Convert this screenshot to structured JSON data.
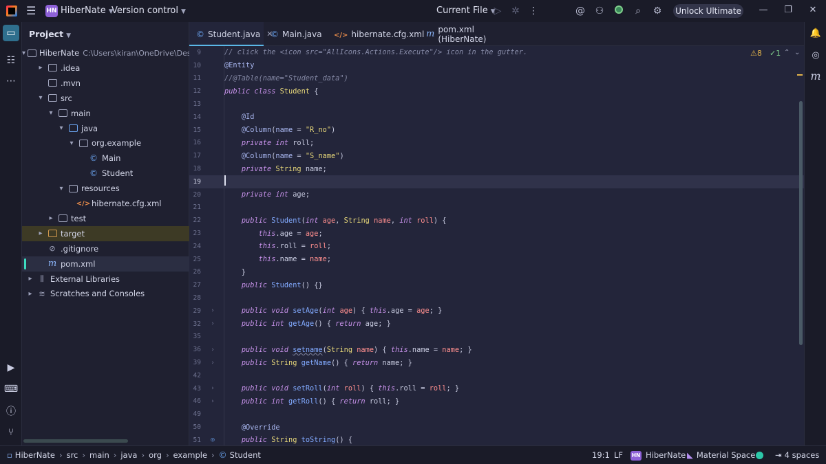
{
  "titlebar": {
    "project_badge": "HN",
    "project_name": "HiberNate",
    "vcs_label": "Version control",
    "run_config": "Current File",
    "unlock_label": "Unlock Ultimate"
  },
  "project_panel": {
    "header": "Project",
    "tree": [
      {
        "label": "HiberNate",
        "path": "C:\\Users\\kiran\\OneDrive\\Deskt",
        "indent": 0,
        "arrow": "▾",
        "icon": "folder"
      },
      {
        "label": ".idea",
        "indent": 1,
        "arrow": "▸",
        "icon": "folder"
      },
      {
        "label": ".mvn",
        "indent": 1,
        "arrow": "",
        "icon": "folder"
      },
      {
        "label": "src",
        "indent": 1,
        "arrow": "▾",
        "icon": "folder"
      },
      {
        "label": "main",
        "indent": 2,
        "arrow": "▾",
        "icon": "folder"
      },
      {
        "label": "java",
        "indent": 3,
        "arrow": "▾",
        "icon": "folder-blue"
      },
      {
        "label": "org.example",
        "indent": 4,
        "arrow": "▾",
        "icon": "folder"
      },
      {
        "label": "Main",
        "indent": 5,
        "arrow": "",
        "icon": "class"
      },
      {
        "label": "Student",
        "indent": 5,
        "arrow": "",
        "icon": "class"
      },
      {
        "label": "resources",
        "indent": 3,
        "arrow": "▾",
        "icon": "folder"
      },
      {
        "label": "hibernate.cfg.xml",
        "indent": 4,
        "arrow": "",
        "icon": "xml"
      },
      {
        "label": "test",
        "indent": 2,
        "arrow": "▸",
        "icon": "folder"
      },
      {
        "label": "target",
        "indent": 1,
        "arrow": "▸",
        "icon": "folder-orange",
        "highlight": "target"
      },
      {
        "label": ".gitignore",
        "indent": 1,
        "arrow": "",
        "icon": "gitignore"
      },
      {
        "label": "pom.xml",
        "indent": 1,
        "arrow": "",
        "icon": "maven",
        "highlight": "selected"
      },
      {
        "label": "External Libraries",
        "indent": 0,
        "arrow": "▸",
        "icon": "libraries"
      },
      {
        "label": "Scratches and Consoles",
        "indent": 0,
        "arrow": "▸",
        "icon": "scratches"
      }
    ]
  },
  "tabs": [
    {
      "label": "Student.java",
      "icon": "class",
      "active": true,
      "closable": true
    },
    {
      "label": "Main.java",
      "icon": "class",
      "active": false
    },
    {
      "label": "hibernate.cfg.xml",
      "icon": "xml",
      "active": false
    },
    {
      "label": "pom.xml (HiberNate)",
      "icon": "maven",
      "active": false
    }
  ],
  "inspections": {
    "warnings": "8",
    "weak_warnings": "1"
  },
  "code": [
    {
      "n": "9",
      "fold": "",
      "html": "<span class=\"cm\">// click the &lt;icon src=\"AllIcons.Actions.Execute\"/&gt; icon in the gutter.</span>"
    },
    {
      "n": "10",
      "fold": "",
      "html": "<span class=\"an\">@Entity</span>"
    },
    {
      "n": "11",
      "fold": "",
      "html": "<span class=\"cm\">//@Table(name=\"Student_data\")</span>"
    },
    {
      "n": "12",
      "fold": "",
      "html": "<span class=\"kw\">public class</span> <span class=\"ty\">Student</span> {"
    },
    {
      "n": "13",
      "fold": "",
      "html": ""
    },
    {
      "n": "14",
      "fold": "",
      "html": "    <span class=\"an\">@Id</span>"
    },
    {
      "n": "15",
      "fold": "",
      "html": "    <span class=\"an\">@Column</span>(<span class=\"an\">name</span> = <span class=\"str\">\"R_no\"</span>)"
    },
    {
      "n": "16",
      "fold": "",
      "html": "    <span class=\"kw\">private int</span> roll;"
    },
    {
      "n": "17",
      "fold": "",
      "html": "    <span class=\"an\">@Column</span>(<span class=\"an\">name</span> = <span class=\"str\">\"S_name\"</span>)"
    },
    {
      "n": "18",
      "fold": "",
      "html": "    <span class=\"kw\">private</span> <span class=\"ty\">String</span> name;"
    },
    {
      "n": "19",
      "fold": "",
      "html": "",
      "current": true
    },
    {
      "n": "20",
      "fold": "",
      "html": "    <span class=\"kw\">private int</span> age;"
    },
    {
      "n": "21",
      "fold": "",
      "html": ""
    },
    {
      "n": "22",
      "fold": "",
      "html": "    <span class=\"kw\">public</span> <span class=\"fn\">Student</span>(<span class=\"kw\">int</span> <span class=\"pr\">age</span>, <span class=\"ty\">String</span> <span class=\"pr\">name</span>, <span class=\"kw\">int</span> <span class=\"pr\">roll</span>) {"
    },
    {
      "n": "23",
      "fold": "",
      "html": "        <span class=\"th\">this</span>.age = <span class=\"pr\">age</span>;"
    },
    {
      "n": "24",
      "fold": "",
      "html": "        <span class=\"th\">this</span>.roll = <span class=\"pr\">roll</span>;"
    },
    {
      "n": "25",
      "fold": "",
      "html": "        <span class=\"th\">this</span>.name = <span class=\"pr\">name</span>;"
    },
    {
      "n": "26",
      "fold": "",
      "html": "    }"
    },
    {
      "n": "27",
      "fold": "",
      "html": "    <span class=\"kw\">public</span> <span class=\"fn\">Student</span>() {}"
    },
    {
      "n": "28",
      "fold": "",
      "html": ""
    },
    {
      "n": "29",
      "fold": "›",
      "html": "    <span class=\"kw\">public void</span> <span class=\"fn\">setAge</span>(<span class=\"kw\">int</span> <span class=\"pr\">age</span>) { <span class=\"th\">this</span>.age = <span class=\"pr\">age</span>; }"
    },
    {
      "n": "32",
      "fold": "›",
      "html": "    <span class=\"kw\">public int</span> <span class=\"fn\">getAge</span>() { <span class=\"kw\">return</span> age; }"
    },
    {
      "n": "35",
      "fold": "",
      "html": ""
    },
    {
      "n": "36",
      "fold": "›",
      "html": "    <span class=\"kw\">public void</span> <span class=\"fn wavy\">setname</span>(<span class=\"ty\">String</span> <span class=\"pr\">name</span>) { <span class=\"th\">this</span>.name = <span class=\"pr\">name</span>; }"
    },
    {
      "n": "39",
      "fold": "›",
      "html": "    <span class=\"kw\">public</span> <span class=\"ty\">String</span> <span class=\"fn\">getName</span>() { <span class=\"kw\">return</span> name; }"
    },
    {
      "n": "42",
      "fold": "",
      "html": ""
    },
    {
      "n": "43",
      "fold": "›",
      "html": "    <span class=\"kw\">public void</span> <span class=\"fn\">setRoll</span>(<span class=\"kw\">int</span> <span class=\"pr\">roll</span>) { <span class=\"th\">this</span>.roll = <span class=\"pr\">roll</span>; }"
    },
    {
      "n": "46",
      "fold": "›",
      "html": "    <span class=\"kw\">public int</span> <span class=\"fn\">getRoll</span>() { <span class=\"kw\">return</span> roll; }"
    },
    {
      "n": "49",
      "fold": "",
      "html": ""
    },
    {
      "n": "50",
      "fold": "",
      "html": "    <span class=\"an\">@Override</span>"
    },
    {
      "n": "51",
      "fold": "◎",
      "html": "    <span class=\"kw\">public</span> <span class=\"ty\">String</span> <span class=\"fn\">toString</span>() {"
    }
  ],
  "statusbar": {
    "breadcrumb": [
      "HiberNate",
      "src",
      "main",
      "java",
      "org",
      "example",
      "Student"
    ],
    "position": "19:1",
    "line_separator": "LF",
    "project_badge": "HN",
    "project_name": "HiberNate",
    "theme": "Material Space",
    "indent": "4 spaces"
  },
  "colors": {
    "accent": "#5bb8e8",
    "selection_marker": "#3ddcc0",
    "badge": "#8e61d8"
  }
}
